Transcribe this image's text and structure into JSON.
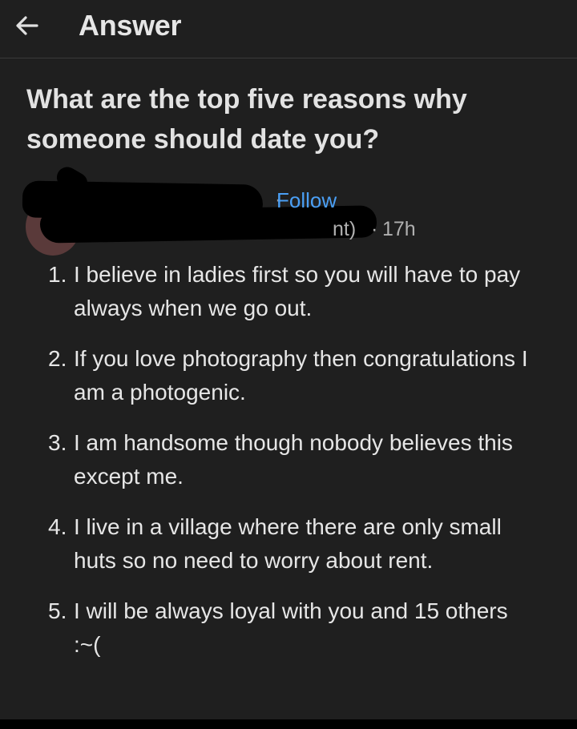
{
  "header": {
    "title": "Answer",
    "back_icon": "arrow-left-icon"
  },
  "question": {
    "text": "What are the top five reasons why someone should date you?"
  },
  "author": {
    "follow_label": "Follow",
    "credential_fragment": "nt)",
    "separator": "·",
    "timestamp": "17h",
    "redacted": true
  },
  "answer": {
    "items": [
      {
        "number": "1.",
        "text": "I believe in ladies first so you will have to pay always when we go out."
      },
      {
        "number": "2.",
        "text": "If you love photography then congratulations I am a photogenic."
      },
      {
        "number": "3.",
        "text": "I am handsome though nobody believes this except me."
      },
      {
        "number": "4.",
        "text": "I live in a village where there are only small huts so no need to worry about rent."
      },
      {
        "number": "5.",
        "text": "I will be always loyal with you and 15 others :~("
      }
    ]
  },
  "colors": {
    "background": "#1f1f1f",
    "link": "#4a9ff5",
    "text": "#e6e6e6",
    "muted": "#b0b0b0"
  }
}
